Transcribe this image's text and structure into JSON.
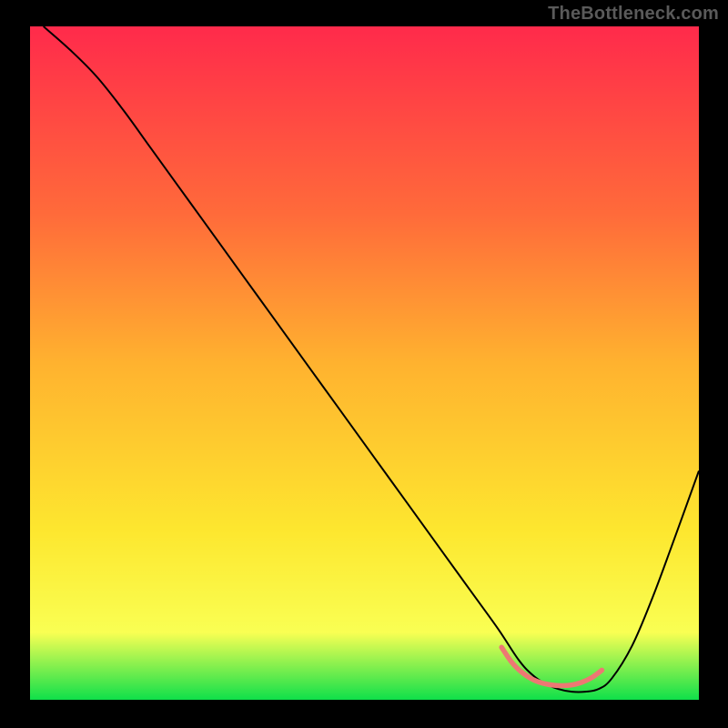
{
  "watermark": "TheBottleneck.com",
  "chart_data": {
    "type": "line",
    "title": "",
    "xlabel": "",
    "ylabel": "",
    "xlim": [
      0,
      100
    ],
    "ylim": [
      0,
      100
    ],
    "gradient_colors": {
      "top": "#ff2a4b",
      "q1": "#ff6b3a",
      "mid": "#ffb22f",
      "q3": "#fde72f",
      "q4": "#f9ff53",
      "bottom": "#0fe04a"
    },
    "series": [
      {
        "name": "main-curve",
        "color": "#000000",
        "stroke_width": 2,
        "x": [
          2,
          6,
          10,
          14,
          18,
          22,
          26,
          30,
          34,
          38,
          42,
          46,
          50,
          54,
          58,
          62,
          66,
          70,
          73,
          75,
          77,
          79,
          81,
          83,
          85,
          87,
          90,
          93,
          96,
          100
        ],
        "y": [
          100,
          96.5,
          92.5,
          87.5,
          82,
          76.5,
          71,
          65.5,
          60,
          54.5,
          49,
          43.5,
          38,
          32.5,
          27,
          21.5,
          16,
          10.5,
          6,
          3.8,
          2.4,
          1.6,
          1.2,
          1.2,
          1.6,
          3.2,
          8,
          15,
          23,
          34
        ]
      },
      {
        "name": "highlight-band",
        "color": "#ed7873",
        "stroke_width": 5.5,
        "x": [
          70.5,
          72,
          73.5,
          75,
          76.5,
          78,
          79.5,
          81,
          82.5,
          84,
          85.5
        ],
        "y": [
          7.8,
          5.6,
          4.1,
          3.1,
          2.5,
          2.2,
          2.1,
          2.2,
          2.6,
          3.3,
          4.4
        ]
      }
    ]
  }
}
